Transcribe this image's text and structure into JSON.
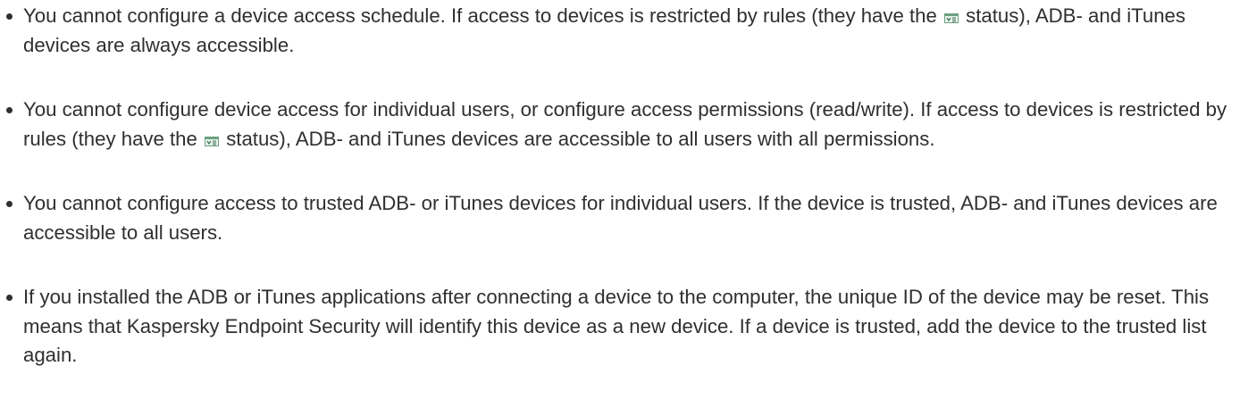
{
  "notes": [
    {
      "before_icon": "You cannot configure a device access schedule. If access to devices is restricted by rules (they have the ",
      "icon": "restricted-status-icon",
      "after_icon": " status), ADB- and iTunes devices are always accessible."
    },
    {
      "before_icon": "You cannot configure device access for individual users, or configure access permissions (read/write). If access to devices is restricted by rules (they have the ",
      "icon": "restricted-status-icon",
      "after_icon": " status), ADB- and iTunes devices are accessible to all users with all permissions."
    },
    {
      "text": "You cannot configure access to trusted ADB- or iTunes devices for individual users. If the device is trusted, ADB- and iTunes devices are accessible to all users."
    },
    {
      "text": "If you installed the ADB or iTunes applications after connecting a device to the computer, the unique ID of the device may be reset. This means that Kaspersky Endpoint Security will identify this device as a new device. If a device is trusted, add the device to the trusted list again."
    }
  ]
}
